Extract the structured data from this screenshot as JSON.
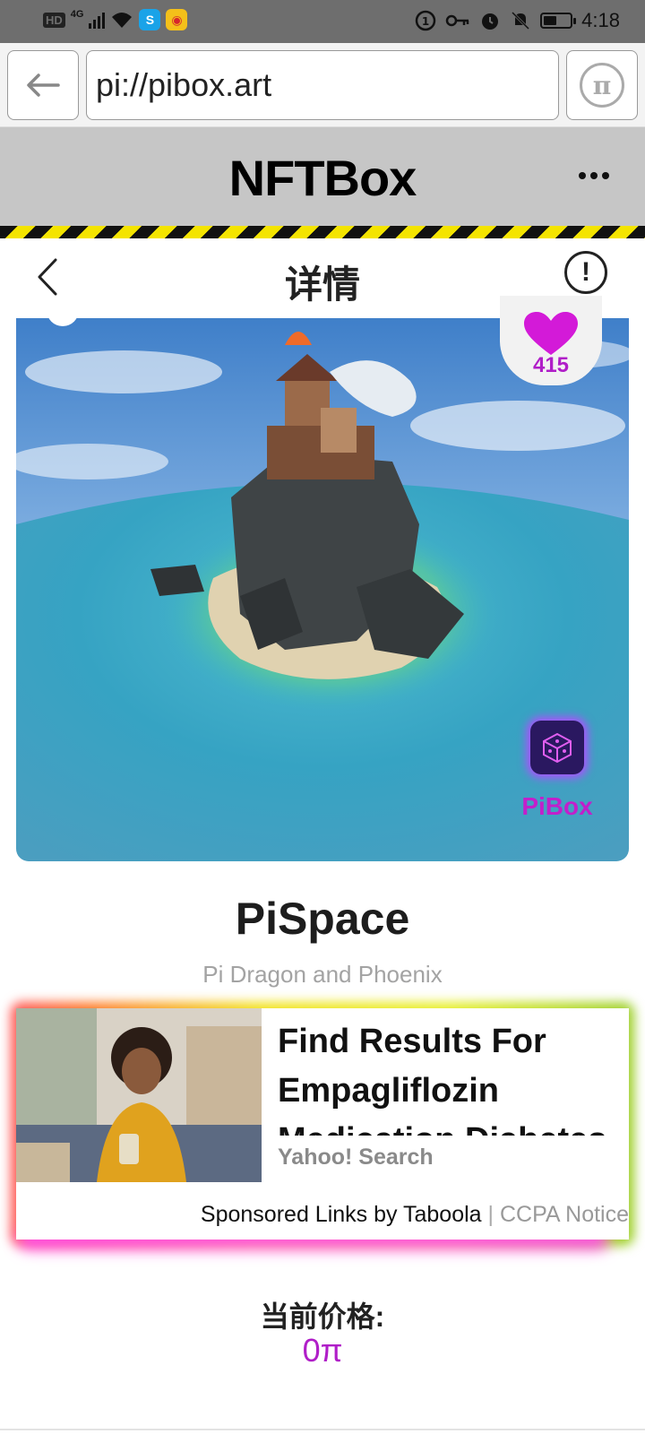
{
  "status_bar": {
    "hd": "HD",
    "network": "4G",
    "time": "4:18"
  },
  "browser": {
    "url": "pi://pibox.art"
  },
  "app": {
    "title": "NFTBox"
  },
  "detail": {
    "title": "详情"
  },
  "artwork": {
    "like_count": "415",
    "brand_label": "PiBox",
    "heart_color": "#d31ad8"
  },
  "nft": {
    "name": "PiSpace",
    "subtitle": "Pi Dragon and Phoenix"
  },
  "ad": {
    "headline": "Find Results For Empagliflozin Medication Diabetes",
    "source": "Yahoo! Search",
    "sponsor_text": "Sponsored Links by Taboola",
    "separator": " | ",
    "ccpa_text": "CCPA Notice"
  },
  "price": {
    "label": "当前价格:",
    "value": "0π"
  },
  "colors": {
    "accent": "#b01ec8",
    "header_bg": "#c6c6c6",
    "hazard_yellow": "#f4e400"
  }
}
